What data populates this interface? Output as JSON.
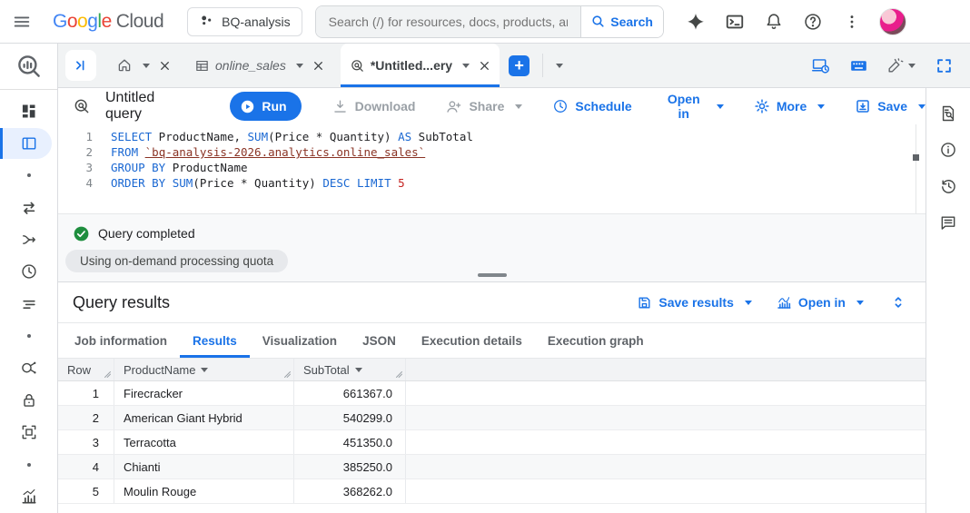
{
  "topbar": {
    "logo_google": "Google",
    "logo_cloud": "Cloud",
    "project": "BQ-analysis",
    "search_placeholder": "Search (/) for resources, docs, products, and more",
    "search_button": "Search"
  },
  "tabbar": {
    "tab_online_sales": "online_sales",
    "tab_untitled": "*Untitled...ery"
  },
  "editor": {
    "title": "Untitled query",
    "run": "Run",
    "download": "Download",
    "share": "Share",
    "schedule": "Schedule",
    "open_in": "Open in",
    "more": "More",
    "save": "Save",
    "line_numbers": [
      "1",
      "2",
      "3",
      "4"
    ],
    "code": {
      "l1": {
        "k1": "SELECT",
        "t1": " ProductName, ",
        "k2": "SUM",
        "t2": "(Price * Quantity) ",
        "k3": "AS",
        "t3": " SubTotal"
      },
      "l2": {
        "k1": "FROM",
        "t1": " ",
        "ref": "`bq-analysis-2026.analytics.online_sales`"
      },
      "l3": {
        "k1": "GROUP BY",
        "t1": " ProductName"
      },
      "l4": {
        "k1": "ORDER BY",
        "t1": " ",
        "k2": "SUM",
        "t2": "(Price * Quantity) ",
        "k3": "DESC",
        "t3": " ",
        "k4": "LIMIT",
        "t4": " ",
        "n1": "5"
      }
    }
  },
  "status": {
    "message": "Query completed",
    "quota_chip": "Using on-demand processing quota"
  },
  "results": {
    "title": "Query results",
    "save_results": "Save results",
    "open_in": "Open in",
    "tabs": [
      "Job information",
      "Results",
      "Visualization",
      "JSON",
      "Execution details",
      "Execution graph"
    ],
    "active_tab": "Results",
    "table": {
      "columns": [
        "Row",
        "ProductName",
        "SubTotal"
      ],
      "rows": [
        [
          "1",
          "Firecracker",
          "661367.0"
        ],
        [
          "2",
          "American Giant Hybrid",
          "540299.0"
        ],
        [
          "3",
          "Terracotta",
          "451350.0"
        ],
        [
          "4",
          "Chianti",
          "385250.0"
        ],
        [
          "5",
          "Moulin Rouge",
          "368262.0"
        ]
      ]
    }
  },
  "icons": {
    "menu": "hamburger-lines",
    "project_selector": "dots-cluster",
    "search": "magnifier",
    "gemini": "four-point-star",
    "cloud_shell": "terminal-prompt",
    "notifications": "bell",
    "help": "question-circle",
    "more_options": "kebab-dots",
    "run": "play-circle",
    "query_completed": "green-check-circle",
    "save": "box-down-arrow",
    "open_in_results": "bar-chart",
    "collapse_panel": "chevron-bar"
  },
  "colors": {
    "accent_blue": "#1a73e8",
    "success_green": "#1e8e3e",
    "keyword_blue": "#1967d2",
    "table_ref_red": "#8a3324",
    "number_red": "#c5221f",
    "strip_gray": "#f1f3f4"
  }
}
